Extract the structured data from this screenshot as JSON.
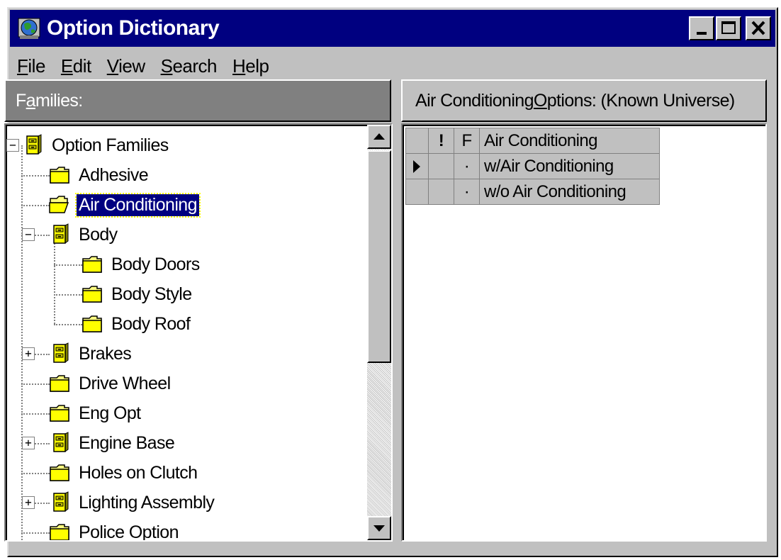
{
  "window": {
    "title": "Option Dictionary",
    "icon": "globe-app-icon"
  },
  "title_buttons": [
    {
      "name": "minimize-button",
      "icon": "minimize-icon"
    },
    {
      "name": "maximize-button",
      "icon": "maximize-icon"
    },
    {
      "name": "close-button",
      "icon": "close-icon"
    }
  ],
  "menu": [
    {
      "label": "File",
      "mnemonic": "F"
    },
    {
      "label": "Edit",
      "mnemonic": "E"
    },
    {
      "label": "View",
      "mnemonic": "V"
    },
    {
      "label": "Search",
      "mnemonic": "S"
    },
    {
      "label": "Help",
      "mnemonic": "H"
    }
  ],
  "families_panel": {
    "header": "Families:",
    "tree": [
      {
        "label": "Option Families",
        "level": 0,
        "icon": "cabinet-icon",
        "expander": "−"
      },
      {
        "label": "Adhesive",
        "level": 1,
        "icon": "folder-closed-icon"
      },
      {
        "label": "Air Conditioning",
        "level": 1,
        "icon": "folder-open-icon",
        "selected": true
      },
      {
        "label": "Body",
        "level": 1,
        "icon": "cabinet-icon",
        "expander": "−"
      },
      {
        "label": "Body Doors",
        "level": 2,
        "icon": "folder-closed-icon"
      },
      {
        "label": "Body Style",
        "level": 2,
        "icon": "folder-closed-icon"
      },
      {
        "label": "Body Roof",
        "level": 2,
        "icon": "folder-closed-icon"
      },
      {
        "label": "Brakes",
        "level": 1,
        "icon": "cabinet-icon",
        "expander": "+"
      },
      {
        "label": "Drive Wheel",
        "level": 1,
        "icon": "folder-closed-icon"
      },
      {
        "label": "Eng Opt",
        "level": 1,
        "icon": "folder-closed-icon"
      },
      {
        "label": "Engine Base",
        "level": 1,
        "icon": "cabinet-icon",
        "expander": "+"
      },
      {
        "label": "Holes on Clutch",
        "level": 1,
        "icon": "folder-closed-icon"
      },
      {
        "label": "Lighting Assembly",
        "level": 1,
        "icon": "cabinet-icon",
        "expander": "+"
      },
      {
        "label": "Police Option",
        "level": 1,
        "icon": "folder-closed-icon"
      }
    ]
  },
  "options_panel": {
    "header": "Air Conditioning Options: (Known Universe)",
    "columns": {
      "flag1": "!",
      "flag2": "F",
      "name": "Air Conditioning"
    },
    "rows": [
      {
        "current": true,
        "flag2": "·",
        "name": "w/Air Conditioning"
      },
      {
        "current": false,
        "flag2": "·",
        "name": "w/o Air Conditioning"
      }
    ]
  },
  "colors": {
    "titlebar": "#000080",
    "face": "#c0c0c0",
    "selection": "#000080"
  }
}
